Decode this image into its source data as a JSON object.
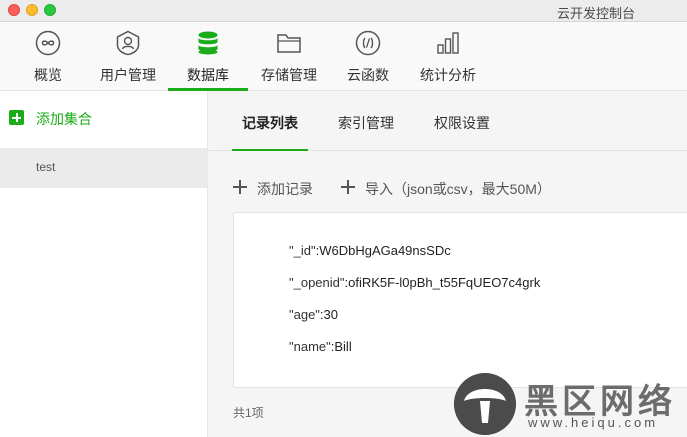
{
  "window": {
    "title": "云开发控制台"
  },
  "toolbar": {
    "items": [
      {
        "label": "概览",
        "icon": "infinity-icon"
      },
      {
        "label": "用户管理",
        "icon": "user-shield-icon"
      },
      {
        "label": "数据库",
        "icon": "database-icon"
      },
      {
        "label": "存储管理",
        "icon": "folder-icon"
      },
      {
        "label": "云函数",
        "icon": "code-function-icon"
      },
      {
        "label": "统计分析",
        "icon": "bar-chart-icon"
      }
    ],
    "active_index": 2
  },
  "sidebar": {
    "add_collection_label": "添加集合",
    "collections": [
      "test"
    ]
  },
  "tabs": {
    "items": [
      "记录列表",
      "索引管理",
      "权限设置"
    ],
    "active_index": 0
  },
  "actions": {
    "add_record_label": "添加记录",
    "import_label": "导入（json或csv，最大50M）"
  },
  "record": {
    "fields": [
      {
        "key": "\"_id\"",
        "value": "W6DbHgAGa49nsSDc"
      },
      {
        "key": "\"_openid\"",
        "value": "ofiRK5F-l0pBh_t55FqUEO7c4grk"
      },
      {
        "key": "\"age\"",
        "value": "30"
      },
      {
        "key": "\"name\"",
        "value": "Bill"
      }
    ]
  },
  "footer": {
    "total_label": "共1项"
  },
  "watermark": {
    "text": "黑区网络",
    "sub": "www.heiqu.com"
  },
  "colors": {
    "accent": "#1aad19"
  }
}
